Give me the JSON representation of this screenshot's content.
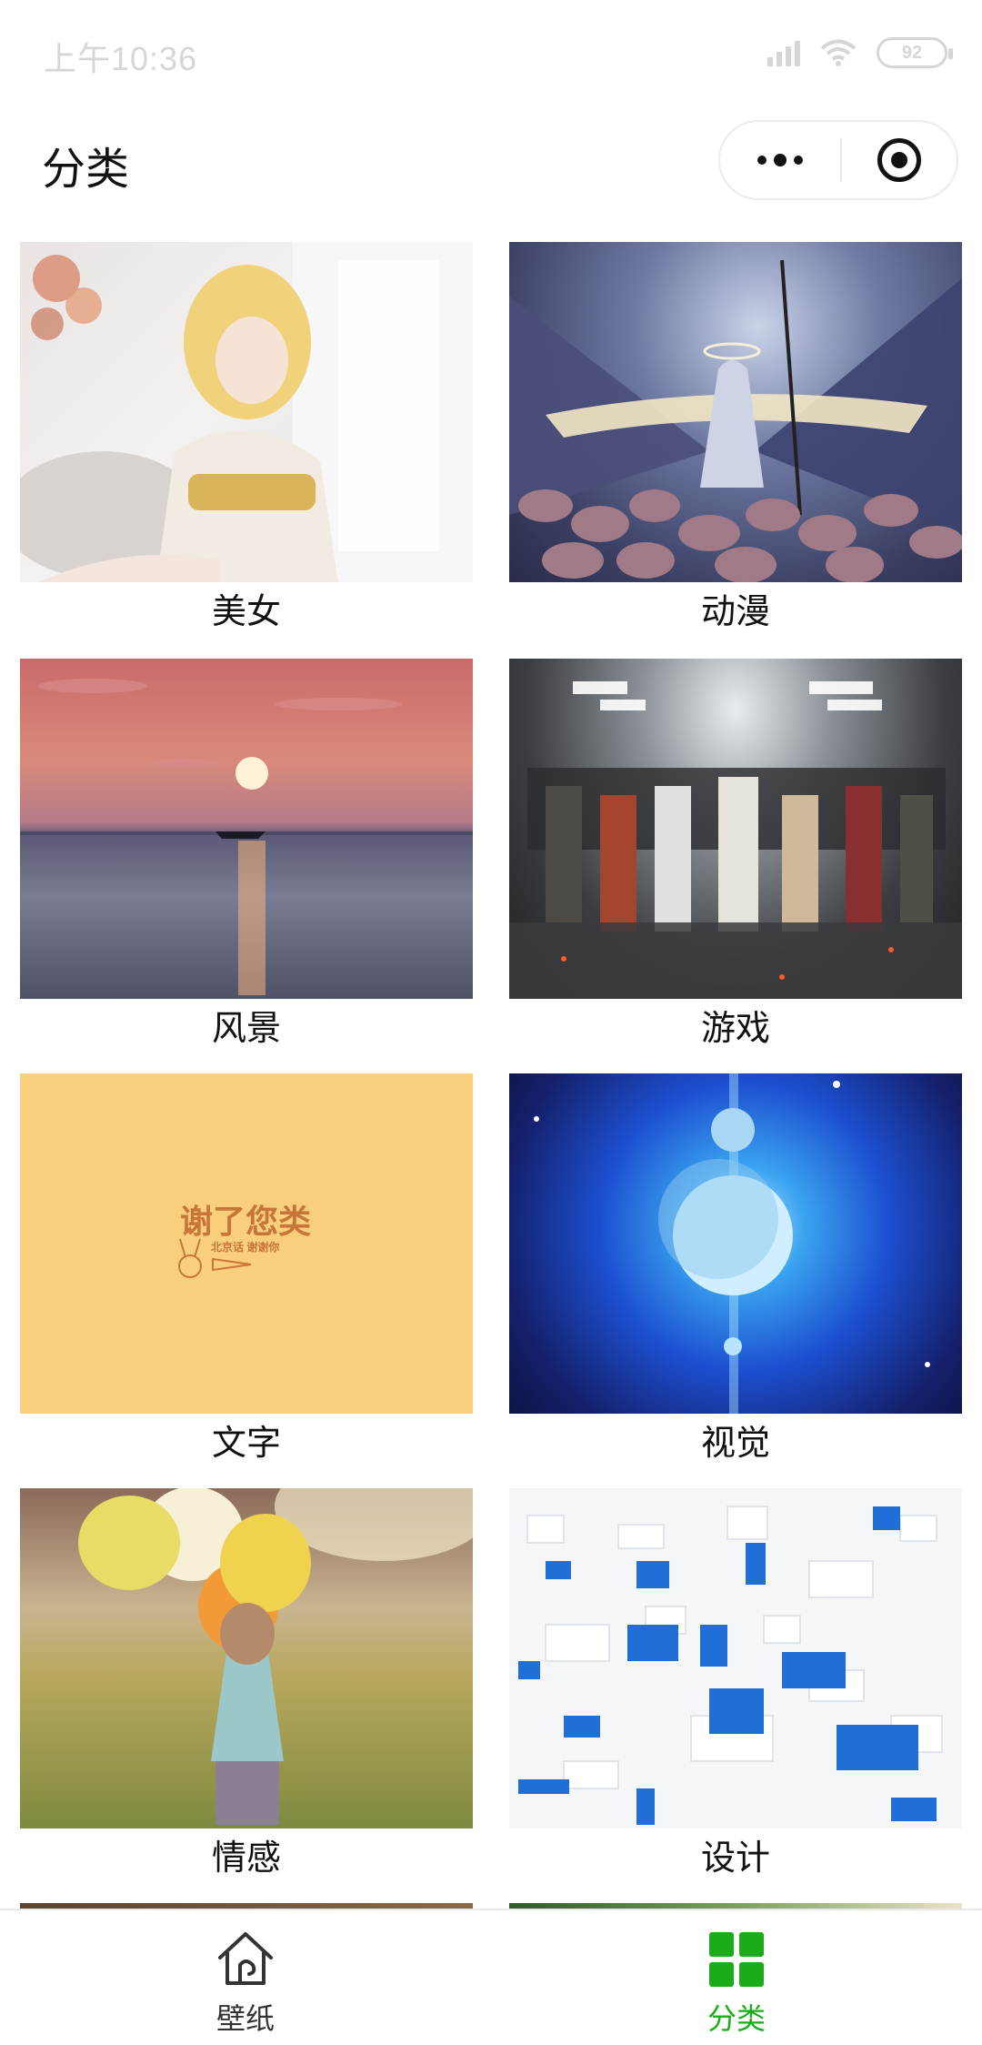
{
  "status_bar": {
    "time": "上午10:36",
    "battery": "92"
  },
  "nav": {
    "title": "分类",
    "more_icon": "more-dots-icon",
    "close_icon": "target-icon"
  },
  "categories": [
    {
      "label": "美女"
    },
    {
      "label": "动漫"
    },
    {
      "label": "风景"
    },
    {
      "label": "游戏"
    },
    {
      "label": "文字",
      "image_text": "谢了您类",
      "image_subtext": "北京话 谢谢你"
    },
    {
      "label": "视觉"
    },
    {
      "label": "情感"
    },
    {
      "label": "设计"
    }
  ],
  "tab_bar": {
    "items": [
      {
        "label": "壁纸",
        "icon": "home-icon"
      },
      {
        "label": "分类",
        "icon": "grid-icon"
      }
    ],
    "active_color": "#1aad19",
    "inactive_color": "#333333"
  }
}
